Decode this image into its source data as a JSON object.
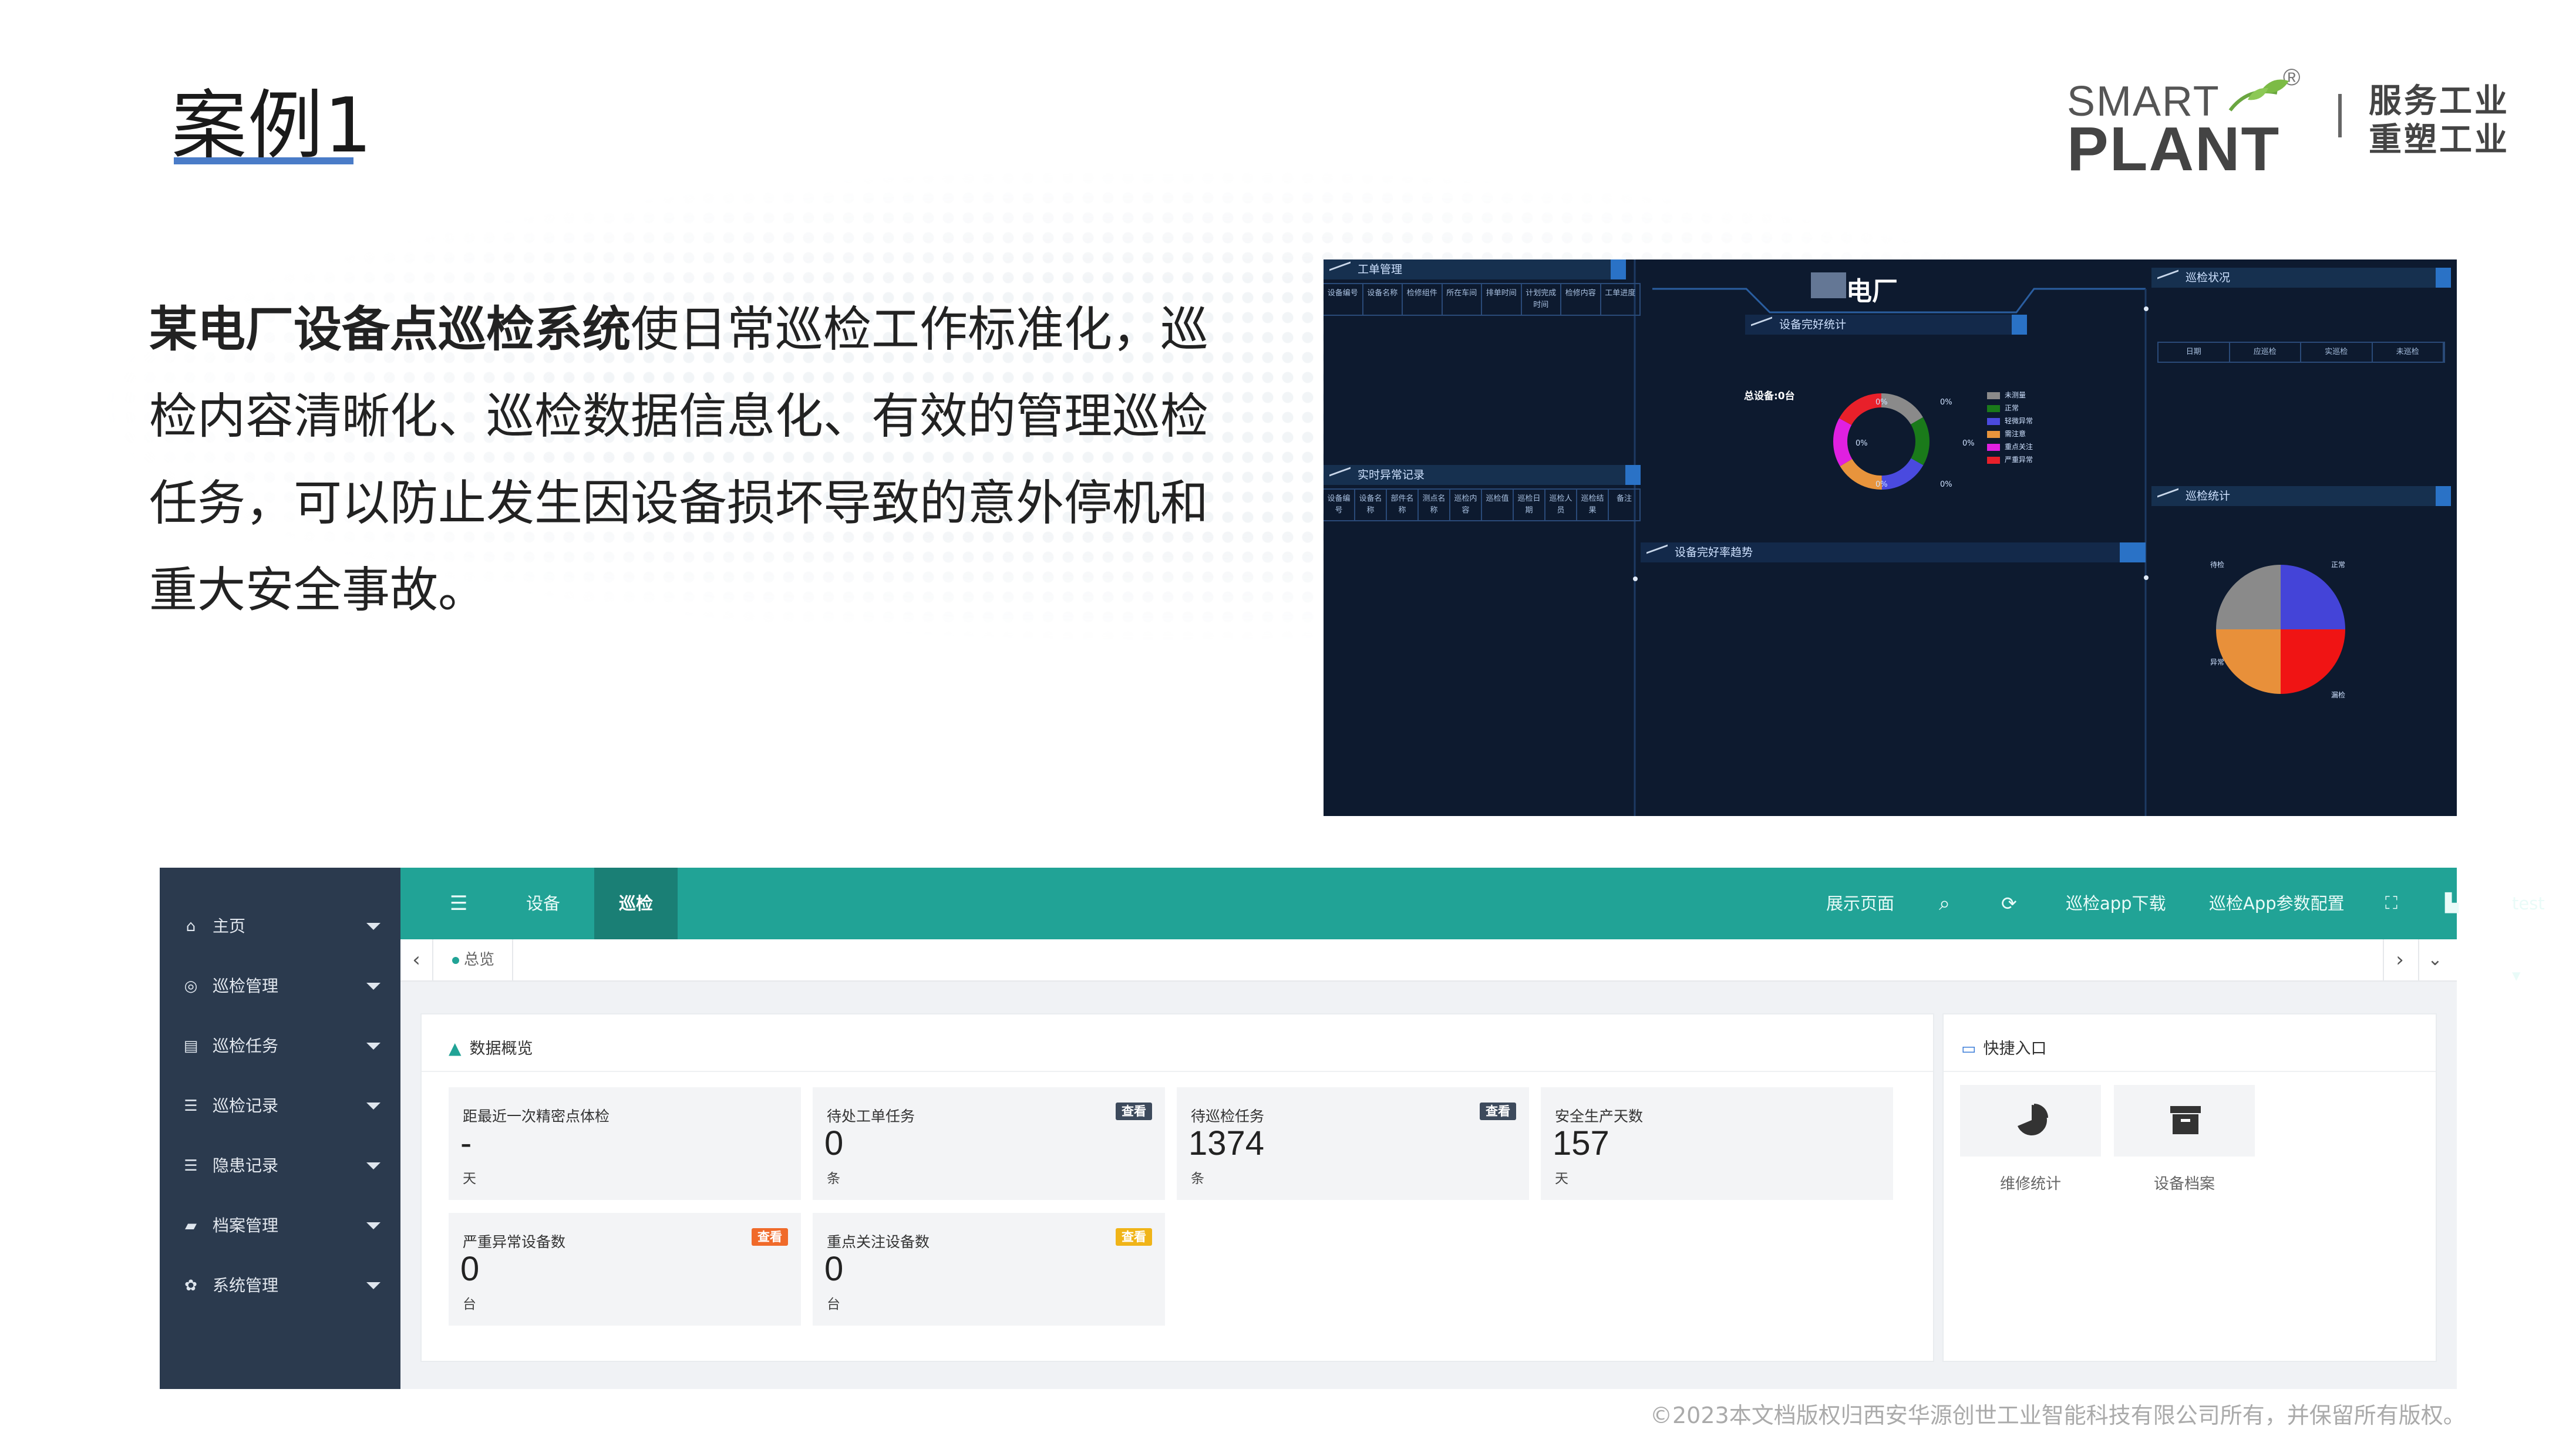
{
  "slide": {
    "title": "案例1",
    "logo": {
      "line1": "SMART",
      "line2": "PLANT",
      "mark": "®"
    },
    "slogan": [
      "服务工业",
      "重塑工业"
    ],
    "paragraph": {
      "bold": "某电厂设备点巡检系统",
      "lines": [
        "使日常巡检工作标准化，巡",
        "检内容清晰化、巡检数据信息化、有效的管理巡检",
        "任务，可以防止发生因设备损坏导致的意外停机和",
        "重大安全事故。"
      ]
    },
    "footer": "©2023本文档版权归西安华源创世工业智能科技有限公司所有，并保留所有版权。"
  },
  "dashboard": {
    "title": "电厂",
    "work_order": {
      "header": "工单管理",
      "cols": [
        "设备编号",
        "设备名称",
        "检修组件",
        "所在车间",
        "排单时间",
        "计划完成时间",
        "检修内容",
        "工单进度"
      ]
    },
    "abnormal": {
      "header": "实时异常记录",
      "cols": [
        "设备编号",
        "设备名称",
        "部件名称",
        "测点名称",
        "巡检内容",
        "巡检值",
        "巡检日期",
        "巡检人员",
        "巡检结果",
        "备注"
      ]
    },
    "completeness": {
      "header": "设备完好统计",
      "total": "总设备:0台",
      "pct": [
        "0%",
        "0%",
        "0%",
        "0%",
        "0%",
        "0%"
      ],
      "legend": [
        "未测量",
        "正常",
        "轻微异常",
        "需注意",
        "重点关注",
        "严重异常"
      ],
      "legend_colors": [
        "#8a8a8a",
        "#1a7a1a",
        "#4a4adf",
        "#e8943c",
        "#e020e0",
        "#e8202a"
      ]
    },
    "trend": {
      "header": "设备完好率趋势"
    },
    "patrol_status": {
      "header": "巡检状况",
      "cols": [
        "日期",
        "应巡检",
        "实巡检",
        "未巡检"
      ]
    },
    "patrol_stats": {
      "header": "巡检统计",
      "labels": [
        "待检",
        "正常",
        "漏检",
        "异常"
      ],
      "pie": [
        {
          "label": "待检",
          "value": 25,
          "color": "#8a8a8a"
        },
        {
          "label": "正常",
          "value": 25,
          "color": "#4444d8"
        },
        {
          "label": "异常",
          "value": 25,
          "color": "#f01414"
        },
        {
          "label": "漏检",
          "value": 25,
          "color": "#e8903a"
        }
      ]
    }
  },
  "admin": {
    "sidebar": [
      {
        "icon": "home-icon",
        "glyph": "⌂",
        "label": "主页"
      },
      {
        "icon": "target-icon",
        "glyph": "◎",
        "label": "巡检管理"
      },
      {
        "icon": "task-icon",
        "glyph": "▤",
        "label": "巡检任务"
      },
      {
        "icon": "list-icon",
        "glyph": "☰",
        "label": "巡检记录"
      },
      {
        "icon": "list-icon",
        "glyph": "☰",
        "label": "隐患记录"
      },
      {
        "icon": "folder-icon",
        "glyph": "▰",
        "label": "档案管理"
      },
      {
        "icon": "gear-icon",
        "glyph": "✿",
        "label": "系统管理"
      }
    ],
    "topbar": {
      "menu_icon": "☰",
      "tabs": [
        "设备",
        "巡检"
      ],
      "active_tab": "巡检",
      "right": [
        "展示页面",
        "巡检app下载",
        "巡检App参数配置",
        "test ▾"
      ]
    },
    "breadcrumb": {
      "current": "总览"
    },
    "overview": {
      "header": "数据概览",
      "cards": [
        {
          "title": "距最近一次精密点体检",
          "value": "-",
          "unit": "天",
          "badge": ""
        },
        {
          "title": "待处工单任务",
          "value": "0",
          "unit": "条",
          "badge": "查看"
        },
        {
          "title": "待巡检任务",
          "value": "1374",
          "unit": "条",
          "badge": "查看"
        },
        {
          "title": "安全生产天数",
          "value": "157",
          "unit": "天",
          "badge": ""
        },
        {
          "title": "严重异常设备数",
          "value": "0",
          "unit": "台",
          "badge": "查看"
        },
        {
          "title": "重点关注设备数",
          "value": "0",
          "unit": "台",
          "badge": "查看"
        }
      ],
      "badge_colors": [
        "#3d4a5c",
        "#3d4a5c",
        "#f06a2a",
        "#f0b418"
      ]
    },
    "quick": {
      "header": "快捷入口",
      "items": [
        "维修统计",
        "设备档案"
      ]
    }
  }
}
